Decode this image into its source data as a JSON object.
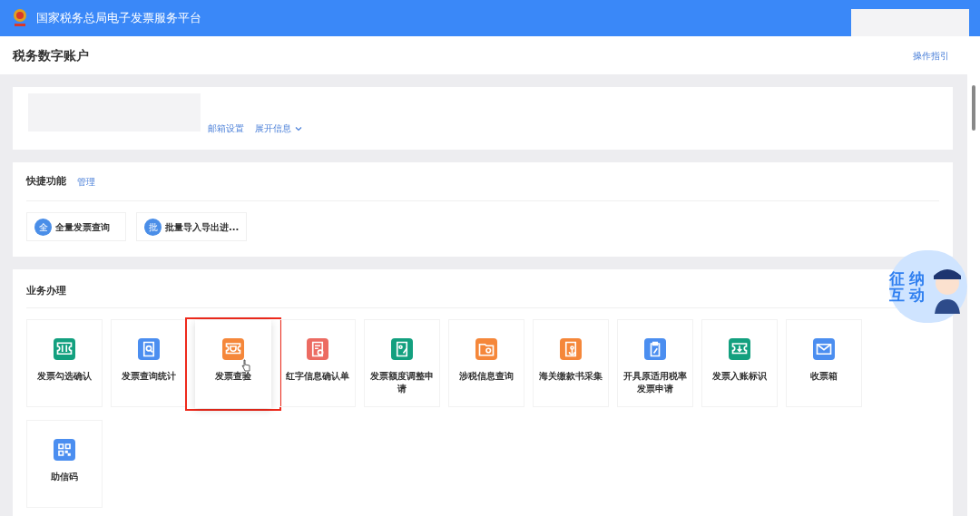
{
  "header": {
    "title": "国家税务总局电子发票服务平台"
  },
  "page": {
    "title": "税务数字账户",
    "guide_link": "操作指引"
  },
  "account": {
    "links": [
      {
        "label": "邮箱设置"
      },
      {
        "label": "展开信息",
        "dropdown": true
      }
    ]
  },
  "shortcuts": {
    "title": "快捷功能",
    "manage_link": "管理",
    "items": [
      {
        "badge": "全",
        "label": "全量发票查询"
      },
      {
        "badge": "批",
        "label": "批量导入导出进..."
      }
    ]
  },
  "business": {
    "title": "业务办理",
    "tiles": [
      {
        "label": "发票勾选确认",
        "kind": "ticket",
        "color": "#13a07f",
        "selected": false
      },
      {
        "label": "发票查询统计",
        "kind": "search-doc",
        "color": "#4b8ef0",
        "selected": false
      },
      {
        "label": "发票查验",
        "kind": "shield-ticket",
        "color": "#f5873a",
        "selected": true
      },
      {
        "label": "红字信息确认单",
        "kind": "check-doc",
        "color": "#ec6b62",
        "selected": false
      },
      {
        "label": "发票额度调整申请",
        "kind": "edit-doc",
        "color": "#13a07f",
        "selected": false
      },
      {
        "label": "涉税信息查询",
        "kind": "folder-search",
        "color": "#f5873a",
        "selected": false
      },
      {
        "label": "海关缴款书采集",
        "kind": "anchor-doc",
        "color": "#f5873a",
        "selected": false
      },
      {
        "label": "开具原适用税率发票申请",
        "kind": "clipboard-pen",
        "color": "#4b8ef0",
        "selected": false
      },
      {
        "label": "发票入账标识",
        "kind": "download-ticket",
        "color": "#13a07f",
        "selected": false
      },
      {
        "label": "收票箱",
        "kind": "envelope",
        "color": "#4b8ef0",
        "selected": false
      },
      {
        "label": "助信码",
        "kind": "qr",
        "color": "#4b8ef0",
        "selected": false
      }
    ]
  },
  "assistant": {
    "label": "征纳互动"
  }
}
